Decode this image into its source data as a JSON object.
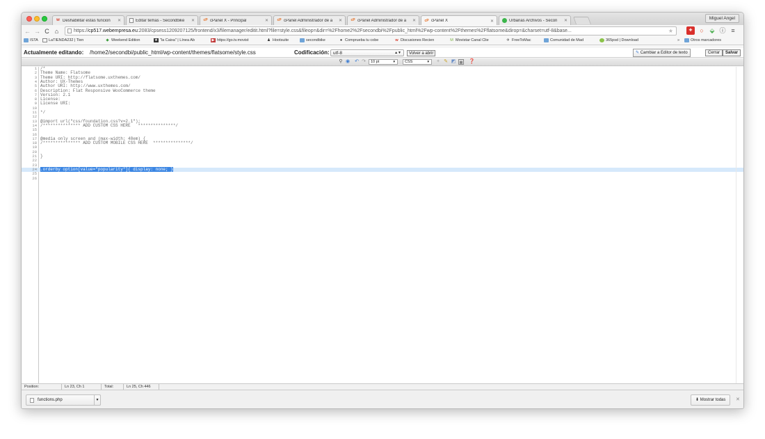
{
  "browser": {
    "profile": "Miguel Angel",
    "tabs": [
      {
        "label": "Deshabilitar estas funcion",
        "icon": "w-icon"
      },
      {
        "label": "Editar temas - Secondbike",
        "icon": "page-icon"
      },
      {
        "label": "cPanel X - Principal",
        "icon": "cpanel-icon"
      },
      {
        "label": "cPanel Administrador de a",
        "icon": "cpanel-icon"
      },
      {
        "label": "cPanel Administrador de a",
        "icon": "cpanel-icon"
      },
      {
        "label": "cPanel X",
        "icon": "cpanel-icon",
        "active": true
      },
      {
        "label": "Urbanas Archivos - Secon",
        "icon": "green-circle-icon"
      }
    ],
    "url_prefix": "https://",
    "url_host": "cp517.webempresa.eu",
    "url_rest": ":2083/cpsess1209207125/frontend/x3/filemanager/editit.html?file=style.css&fileop=&dir=%2Fhome2%2Fsecondbi%2Fpublic_html%2Fwp-content%2Fthemes%2Fflatsome&dirop=&charset=utf-8&base...",
    "bookmarks": [
      "ISTA",
      "LaTIENDA232 | Tien",
      "Weekend Edition",
      "\"la Caixa\" | Línea Ab",
      "https://go.tv.movist",
      "Hootsuite",
      "secondbike",
      "Comprueba tu cobe",
      "Discusiones Recien",
      "Movistar Canal Clie",
      "FreeToMac",
      "Comunidad de Mad",
      "365psd | Download",
      "»",
      "Otros marcadores"
    ]
  },
  "editor": {
    "editing_label": "Actualmente editando:",
    "path": "/home2/secondbi/public_html/wp-content/themes/flatsome/style.css",
    "encoding_label": "Codificación:",
    "encoding_value": "utf-8",
    "reopen_button": "Volver a abrir",
    "switch_editor_button": "Cambiar a Editor de texto",
    "close_button": "Cerrar",
    "save_button": "Salvar",
    "font_size": "10 pt",
    "syntax": "CSS",
    "lines": [
      "/*",
      "Theme Name: Flatsome",
      "Theme URI: http://flatsome.uxthemes.com/",
      "Author: UX-Themes",
      "Author URI: http://www.uxthemes.com/",
      "Description: Flat Responsive WooCommerce theme",
      "Version: 2.1",
      "License:",
      "License URI:",
      "",
      "*/",
      "",
      "@import url(\"css/foundation.css?v=2.1\");",
      "/*************** ADD CUSTOM CSS HERE   ***************/",
      "",
      "",
      "@media only screen and (max-width: 48em) {",
      "/*************** ADD CUSTOM MOBILE CSS HERE  ***************/",
      "",
      "",
      "}",
      "",
      "",
      ".orderby option[value=\"popularity\"]{ display: none; }",
      "",
      ""
    ],
    "status_position_label": "Position:",
    "status_position": "Ln 23, Ch 1",
    "status_total_label": "Total:",
    "status_total": "Ln 25, Ch 446"
  },
  "downloads": {
    "file": "functions.php",
    "show_all": "Mostrar todas"
  }
}
